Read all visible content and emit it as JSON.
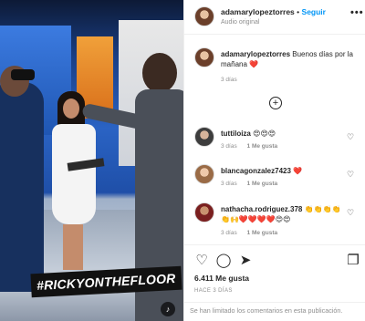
{
  "media": {
    "hashtag": "#RICKYONTHEFLOOR",
    "sound_icon": "speaker-icon"
  },
  "header": {
    "username": "adamarylopeztorres",
    "separator": "•",
    "follow_label": "Seguir",
    "subtitle": "Audio original",
    "more_icon": "•••"
  },
  "caption": {
    "username": "adamarylopeztorres",
    "text": "Buenos días por la mañana",
    "emoji": "❤️",
    "time": "3 días"
  },
  "load_more_icon": "+",
  "comments": [
    {
      "username": "tuttiloiza",
      "text": "😍😍😍",
      "time": "3 días",
      "likes": "1 Me gusta"
    },
    {
      "username": "blancagonzalez7423",
      "text": "❤️",
      "time": "3 días",
      "likes": "1 Me gusta"
    },
    {
      "username": "nathacha.rodriguez.378",
      "text": "👏👏👏👏👏🙌❤️❤️❤️❤️😍😍",
      "time": "3 días",
      "likes": "1 Me gusta"
    }
  ],
  "actions": {
    "like_icon": "♡",
    "comment_icon": "◯",
    "share_icon": "➤",
    "save_icon": "❐"
  },
  "likes": "6.411 Me gusta",
  "ago": "HACE 3 DÍAS",
  "comments_limited": "Se han limitado los comentarios en esta publicación."
}
